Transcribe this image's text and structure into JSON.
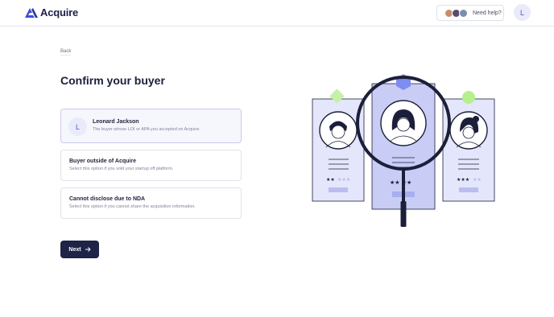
{
  "header": {
    "brand": "Acquire",
    "help_label": "Need help?",
    "user_initial": "L",
    "helper_avatar_colors": [
      "#c98d6a",
      "#5a4a6e",
      "#7a8fb0"
    ]
  },
  "page": {
    "back_label": "Back",
    "title": "Confirm your buyer"
  },
  "options": [
    {
      "initial": "L",
      "title": "Leonard Jackson",
      "description": "The buyer whose LOI or APA you accepted on Acquire.",
      "selected": true
    },
    {
      "title": "Buyer outside of Acquire",
      "description": "Select this option if you sold your startup off platform.",
      "selected": false
    },
    {
      "title": "Cannot disclose due to NDA",
      "description": "Select this option if you cannot share the acquisition information.",
      "selected": false
    }
  ],
  "actions": {
    "next_label": "Next"
  },
  "colors": {
    "brand": "#3d4ddb",
    "primary_button": "#1e2348",
    "card_fill": "#e4e6fb",
    "accent_green": "#b6f08c",
    "accent_blue": "#7f8cf0"
  },
  "icons": {
    "logo": "acquire-logo-icon",
    "next": "arrow-right-icon"
  }
}
